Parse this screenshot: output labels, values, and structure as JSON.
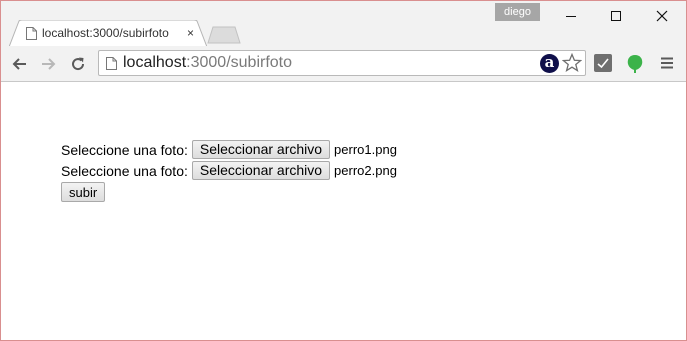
{
  "window": {
    "user_name": "diego"
  },
  "tab": {
    "title": "localhost:3000/subirfoto",
    "close_glyph": "×"
  },
  "toolbar": {
    "url_host": "localhost",
    "url_rest": ":3000/subirfoto",
    "extension_a_label": "a"
  },
  "icons": {
    "back": "back-arrow-icon",
    "forward": "forward-arrow-icon",
    "reload": "reload-icon",
    "page": "page-icon",
    "bookmark": "star-icon",
    "extension_check": "check-extension-icon",
    "extension_leaf": "leaf-extension-icon",
    "menu": "hamburger-menu-icon",
    "minimize": "minimize-icon",
    "maximize": "maximize-icon",
    "close": "close-icon"
  },
  "form": {
    "rows": [
      {
        "label": "Seleccione una foto:",
        "button": "Seleccionar archivo",
        "file": "perro1.png"
      },
      {
        "label": "Seleccione una foto:",
        "button": "Seleccionar archivo",
        "file": "perro2.png"
      }
    ],
    "submit_label": "subir"
  },
  "colors": {
    "window_border": "#d98f8f",
    "chrome_bg": "#f2f2f2",
    "user_badge_bg": "#a6a6a6",
    "leaf_green": "#3cb34a",
    "extension_a_bg": "#0f0f4a"
  }
}
